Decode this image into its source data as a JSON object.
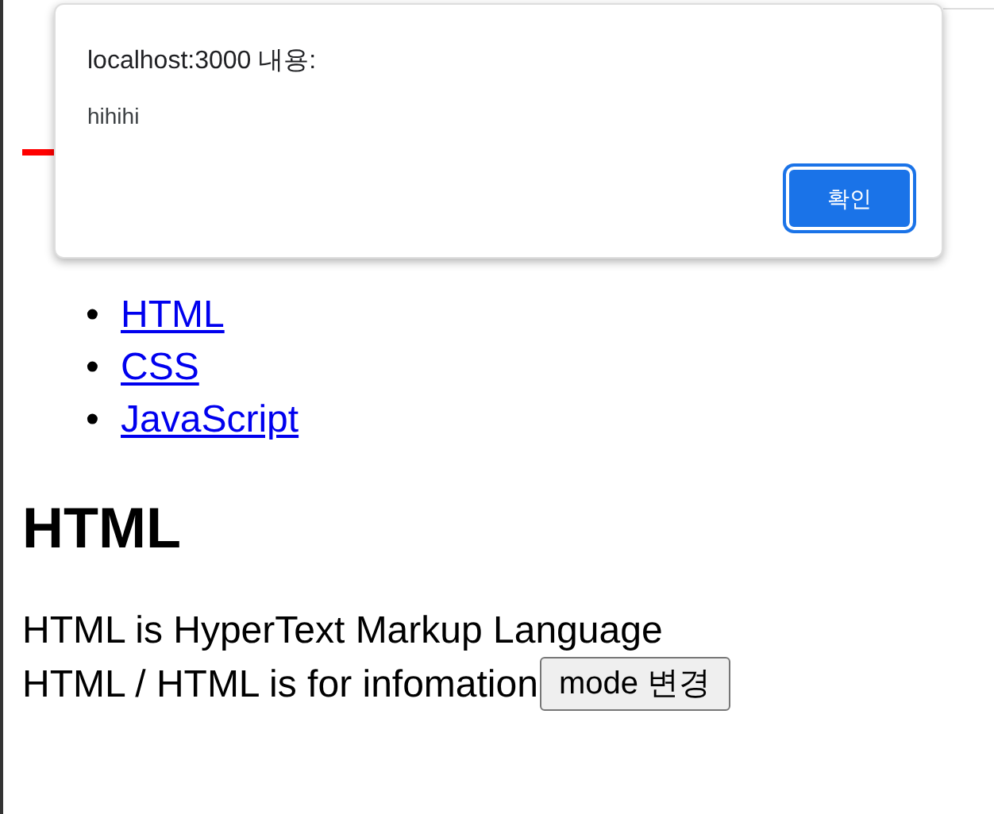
{
  "page": {
    "nav_links": [
      {
        "marker": "•",
        "label": "HTML"
      },
      {
        "marker": "•",
        "label": "CSS"
      },
      {
        "marker": "•",
        "label": "JavaScript"
      }
    ],
    "section_title": "HTML",
    "lines": [
      "HTML is HyperText Markup Language",
      "HTML / HTML is for infomation"
    ],
    "mode_button": "mode 변경"
  },
  "alert": {
    "title": "localhost:3000 내용:",
    "message": "hihihi",
    "ok_button": "확인"
  }
}
